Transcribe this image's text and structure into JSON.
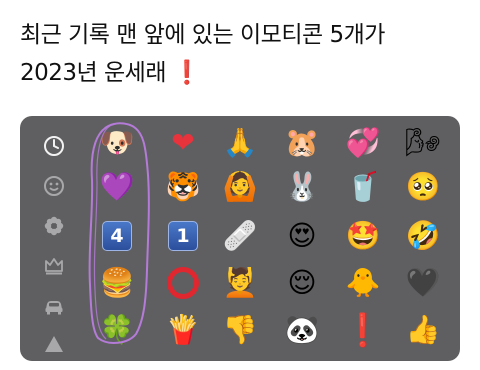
{
  "caption": {
    "line1": "최근 기록 맨 앞에 있는 이모티콘 5개가",
    "line2": "2023년 운세래",
    "mark": "❗"
  },
  "categories": [
    {
      "name": "recent-clock-icon"
    },
    {
      "name": "smiley-icon"
    },
    {
      "name": "flower-icon"
    },
    {
      "name": "crown-icon"
    },
    {
      "name": "car-icon"
    },
    {
      "name": "triangle-icon"
    }
  ],
  "emoji": {
    "r0": [
      "🐶",
      "❤",
      "🙏",
      "🐹",
      "💞",
      "🌬"
    ],
    "r1": [
      "💜",
      "🐯",
      "🙆",
      "🐰",
      "🥤",
      "🥺"
    ],
    "r2": [
      "4",
      "1",
      "🩹",
      "😍",
      "🤩",
      "🤣"
    ],
    "r3": [
      "🍔",
      "⭕",
      "💆",
      "😌",
      "🐥",
      "🖤"
    ],
    "r4": [
      "🍀",
      "🍟",
      "👎",
      "🐼",
      "❗",
      "👍"
    ]
  },
  "colors": {
    "keyboard_bg": "#5f5f61",
    "lasso": "#b57bd8"
  }
}
